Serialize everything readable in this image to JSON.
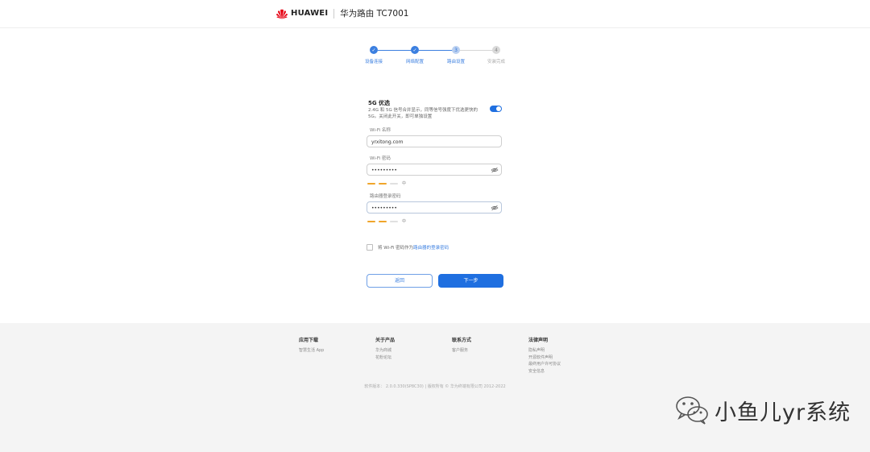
{
  "header": {
    "brand": "HUAWEI",
    "product_title": "华为路由 TC7001"
  },
  "steps": [
    {
      "label": "设备连接",
      "state": "done",
      "mark": "✓"
    },
    {
      "label": "网络配置",
      "state": "done",
      "mark": "✓"
    },
    {
      "label": "路由设置",
      "state": "current",
      "mark": "3"
    },
    {
      "label": "安装完成",
      "state": "todo",
      "mark": "4"
    }
  ],
  "form": {
    "g5_title": "5G 优选",
    "g5_desc": "2.4G 和 5G 信号合并显示，同等信号强度下优选更快的 5G。关闭此开关，即可单独设置",
    "g5_enabled": true,
    "wifi_name_label": "Wi-Fi 名称",
    "wifi_name_value": "yrxitong.com",
    "wifi_pwd_label": "Wi-Fi 密码",
    "wifi_pwd_value": "•••••••••",
    "wifi_pwd_strength": "中",
    "router_pwd_label": "路由器登录密码",
    "router_pwd_value": "•••••••••",
    "router_pwd_strength": "中",
    "checkbox_text": "将 Wi-Fi 密码作为",
    "checkbox_link": "路由器的登录密码",
    "back_label": "返回",
    "next_label": "下一步"
  },
  "footer": {
    "columns": [
      {
        "title": "应用下载",
        "links": [
          "智慧生活 App"
        ]
      },
      {
        "title": "关于产品",
        "links": [
          "华为商城",
          "花粉论坛"
        ]
      },
      {
        "title": "联系方式",
        "links": [
          "客户服务"
        ]
      },
      {
        "title": "法律声明",
        "links": [
          "隐私声明",
          "开源软件声明",
          "最终用户许可协议",
          "安全信息"
        ]
      }
    ],
    "copyright": "软件版本： 2.0.0.330(SP8C30) | 版权所有 © 华为终端有限公司 2012-2022"
  },
  "watermark": {
    "text": "小鱼儿yr系统"
  },
  "colors": {
    "accent": "#1f6fe0",
    "strength": "#f0a52a",
    "logo": "#e60012"
  }
}
